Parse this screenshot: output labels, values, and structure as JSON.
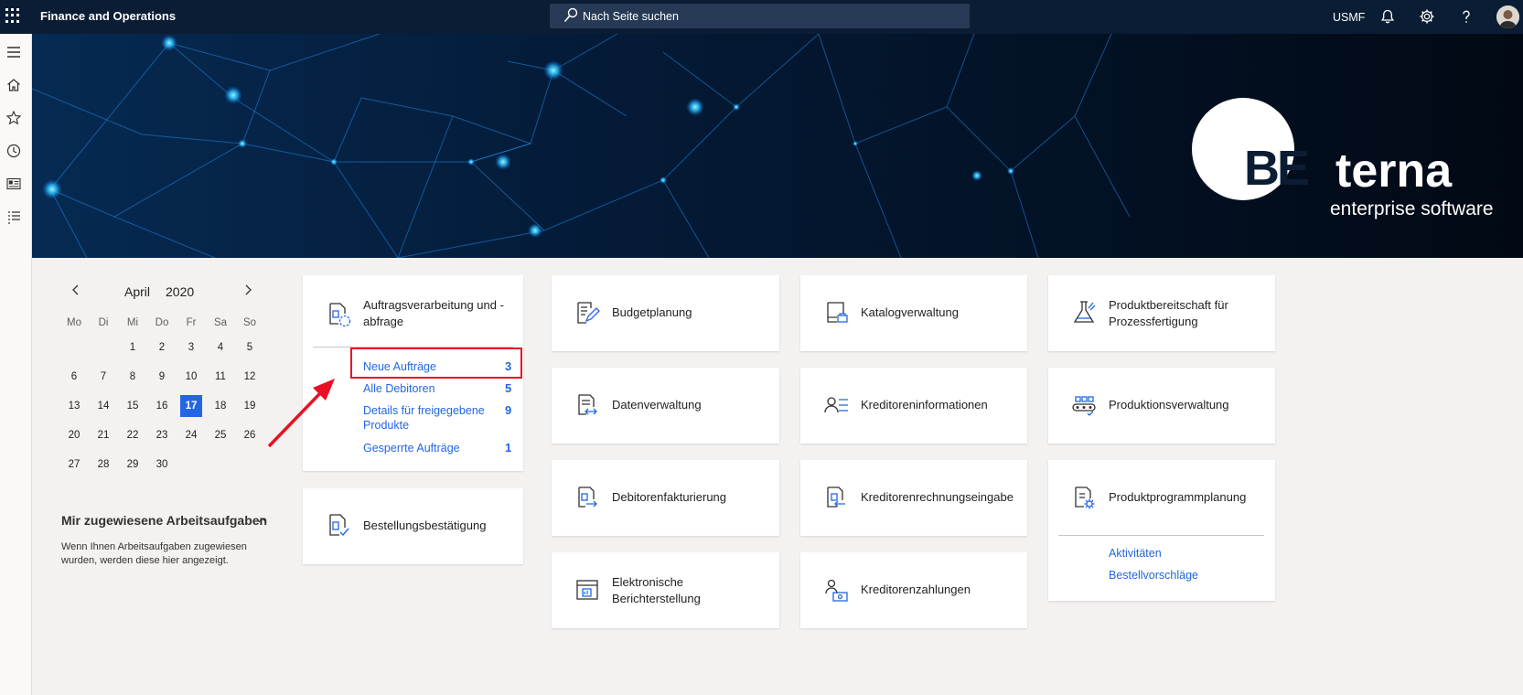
{
  "topbar": {
    "app_title": "Finance and Operations",
    "search_placeholder": "Nach Seite suchen",
    "company": "USMF",
    "icons": [
      "waffle-icon",
      "bell-icon",
      "gear-icon",
      "help-icon",
      "avatar"
    ]
  },
  "navrail": {
    "icons": [
      "hamburger-icon",
      "home-icon",
      "star-icon",
      "recent-clock-icon",
      "workspaces-icon",
      "modules-list-icon"
    ]
  },
  "banner": {
    "logo_be": "BE",
    "logo_terna": "terna",
    "logo_sub": "enterprise software"
  },
  "calendar": {
    "month": "April",
    "year": "2020",
    "weekdays": [
      "Mo",
      "Di",
      "Mi",
      "Do",
      "Fr",
      "Sa",
      "So"
    ],
    "leading_blanks": 2,
    "days": [
      "1",
      "2",
      "3",
      "4",
      "5",
      "6",
      "7",
      "8",
      "9",
      "10",
      "11",
      "12",
      "13",
      "14",
      "15",
      "16",
      "17",
      "18",
      "19",
      "20",
      "21",
      "22",
      "23",
      "24",
      "25",
      "26",
      "27",
      "28",
      "29",
      "30"
    ],
    "today": "17"
  },
  "tasks": {
    "title": "Mir zugewiesene Arbeitsaufgaben",
    "body": "Wenn Ihnen Arbeitsaufgaben zugewiesen wurden, werden diese hier angezeigt."
  },
  "tiles": {
    "auftrag": {
      "label": "Auftragsverarbeitung und -abfrage",
      "links": [
        {
          "label": "Neue Aufträge",
          "count": "3"
        },
        {
          "label": "Alle Debitoren",
          "count": "5"
        },
        {
          "label": "Details für freigegebene Produkte",
          "count": "9"
        },
        {
          "label": "Gesperrte Aufträge",
          "count": "1"
        }
      ]
    },
    "bestellung": {
      "label": "Bestellungsbestätigung"
    },
    "budget": {
      "label": "Budgetplanung"
    },
    "daten": {
      "label": "Datenverwaltung"
    },
    "debitoren": {
      "label": "Debitorenfakturierung"
    },
    "elektronisch": {
      "label": "Elektronische Berichterstellung"
    },
    "katalog": {
      "label": "Katalogverwaltung"
    },
    "kred_info": {
      "label": "Kreditoreninformationen"
    },
    "kred_rech": {
      "label": "Kreditorenrechnungseingabe"
    },
    "kred_zahl": {
      "label": "Kreditorenzahlungen"
    },
    "prod_bereit": {
      "label": "Produktbereitschaft für Prozessfertigung"
    },
    "prod_verw": {
      "label": "Produktionsverwaltung"
    },
    "prod_prog": {
      "label": "Produktprogrammplanung",
      "links": [
        {
          "label": "Aktivitäten"
        },
        {
          "label": "Bestellvorschläge"
        }
      ]
    }
  },
  "colors": {
    "topbar": "#0b1d35",
    "accent": "#2266e3",
    "highlight": "#e81123"
  }
}
